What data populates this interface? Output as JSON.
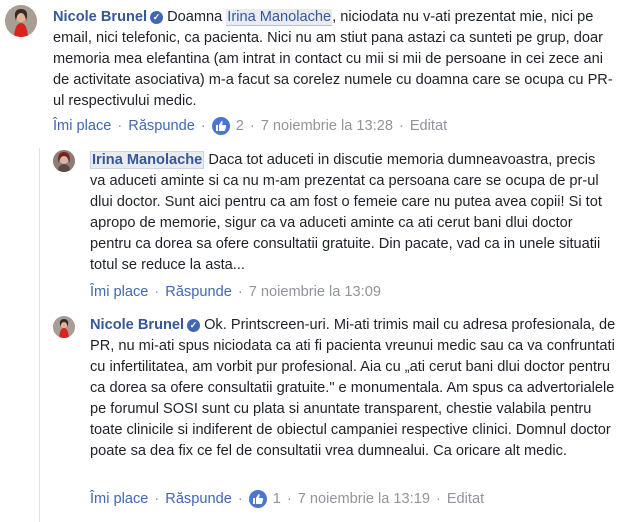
{
  "comments": [
    {
      "author": "Nicole Brunel",
      "mention": "Irina Manolache",
      "text_before": "Doamna ",
      "text_after": ", niciodata nu v-ati prezentat mie, nici pe email, nici telefonic, ca pacienta. Nici nu am stiut pana astazi ca sunteti pe grup, doar memoria mea elefantina (am intrat in contact cu mii si mii de persoane in cei zece ani de activitate asociativa) m-a facut sa corelez numele cu doamna care se ocupa cu PR-ul respectivului medic.",
      "like_label": "Îmi place",
      "reply_label": "Răspunde",
      "reactions": "2",
      "timestamp": "7 noiembrie la 13:28",
      "edited": "Editat"
    },
    {
      "author": "Irina Manolache",
      "text": "Daca tot aduceti in discutie memoria dumneavoastra, precis va aduceti aminte si ca nu m-am prezentat ca persoana care se ocupa de pr-ul dlui doctor. Sunt aici pentru ca am fost o femeie care nu putea avea copii! Si tot apropo de memorie, sigur ca va aduceti aminte ca ati cerut bani dlui doctor pentru ca dorea sa ofere consultatii gratuite. Din pacate, vad ca in unele situatii totul se reduce la asta...",
      "like_label": "Îmi place",
      "reply_label": "Răspunde",
      "timestamp": "7 noiembrie la 13:09"
    },
    {
      "author": "Nicole Brunel",
      "text": "Ok. Printscreen-uri. Mi-ati trimis mail cu adresa profesionala, de PR, nu mi-ati spus niciodata ca ati fi pacienta vreunui medic sau ca va confruntati cu infertilitatea, am vorbit pur profesional. Aia cu „ati cerut bani dlui doctor pentru ca dorea sa ofere consultatii gratuite.\" e monumentala. Am spus ca advertorialele pe forumul SOSI sunt cu plata si anuntate transparent, chestie valabila pentru toate clinicile si indiferent de obiectul campaniei respective clinici. Domnul doctor poate sa dea fix ce fel de consultatii vrea dumnealui. Ca oricare alt medic.",
      "like_label": "Îmi place",
      "reply_label": "Răspunde",
      "reactions": "1",
      "timestamp": "7 noiembrie la 13:19",
      "edited": "Editat"
    }
  ],
  "icons": {
    "verified": "verified-badge-icon",
    "like": "like-thumb-icon"
  },
  "colors": {
    "name": "#365899",
    "link": "#4267b2",
    "meta": "#90949c",
    "like_badge": "#4a76d0"
  }
}
